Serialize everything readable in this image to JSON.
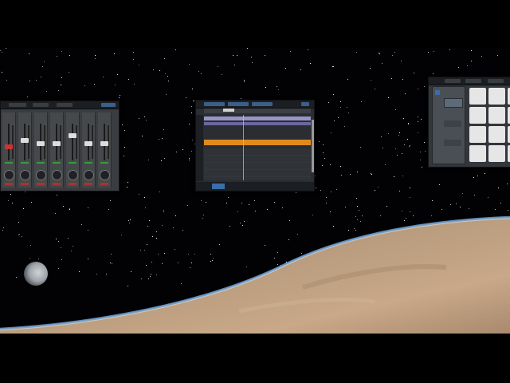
{
  "scene": {
    "description_visible_text": "",
    "windows": [
      {
        "name": "mixer-window"
      },
      {
        "name": "arranger-window"
      },
      {
        "name": "drum-pads-window"
      }
    ]
  },
  "mixer": {
    "channels": 7,
    "fader_levels": [
      0.35,
      0.55,
      0.45,
      0.45,
      0.7,
      0.45,
      0.45
    ]
  },
  "arranger": {
    "tracks": [
      "purple",
      "orange"
    ],
    "colors": {
      "purple": "#7a72b8",
      "orange": "#e08a1e",
      "accent": "#3a6ea8"
    }
  },
  "drum_pads": {
    "rows": 4,
    "cols": 3
  },
  "colors": {
    "background": "#000000",
    "planet": "#b89a7a",
    "atmosphere": "#6fa3d8"
  }
}
